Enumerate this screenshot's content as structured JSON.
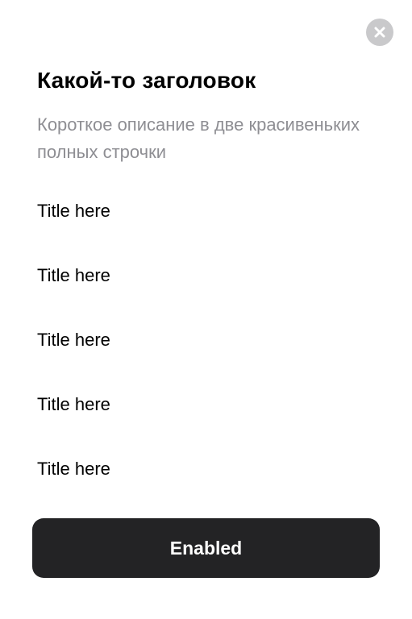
{
  "header": {
    "close_icon": "close-icon",
    "close_color": "#c9c9cb"
  },
  "content": {
    "title": "Какой-то заголовок",
    "description": "Короткое описание в две красивеньких полных строчки"
  },
  "list": {
    "items": [
      {
        "label": "Title here"
      },
      {
        "label": "Title here"
      },
      {
        "label": "Title here"
      },
      {
        "label": "Title here"
      },
      {
        "label": "Title here"
      }
    ]
  },
  "footer": {
    "button_label": "Enabled",
    "button_color": "#232325"
  }
}
